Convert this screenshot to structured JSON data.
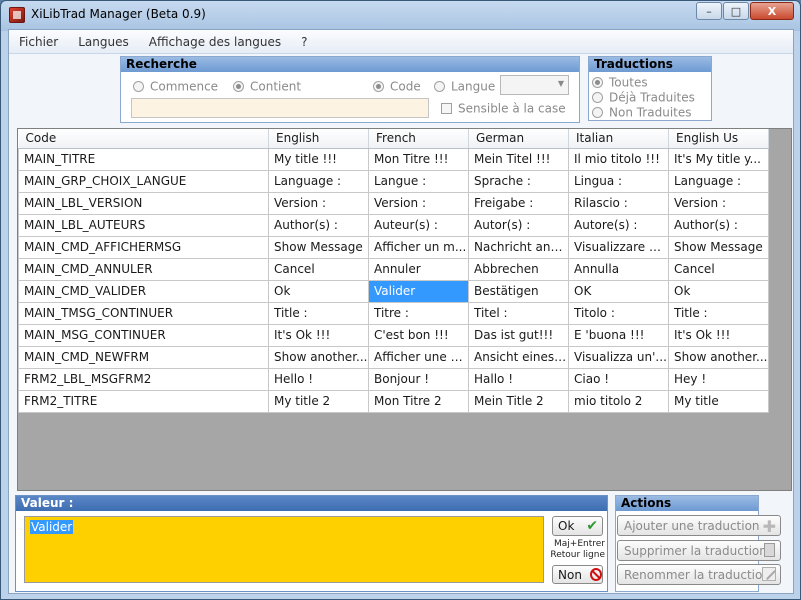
{
  "window": {
    "title": "XiLibTrad Manager (Beta 0.9)",
    "min": "–",
    "max": "□",
    "close": "X"
  },
  "menu": [
    "Fichier",
    "Langues",
    "Affichage des langues",
    "?"
  ],
  "recherche": {
    "title": "Recherche",
    "commence": "Commence",
    "contient": "Contient",
    "code": "Code",
    "langue": "Langue",
    "sensible": "Sensible à la case",
    "search_value": ""
  },
  "traductions": {
    "title": "Traductions",
    "toutes": "Toutes",
    "deja": "Déjà Traduites",
    "non": "Non Traduites"
  },
  "grid": {
    "headers": [
      "Code",
      "English",
      "French",
      "German",
      "Italian",
      "English Us"
    ],
    "rows": [
      [
        "MAIN_TITRE",
        "My title !!!",
        "Mon Titre !!!",
        "Mein Titel !!!",
        "Il mio titolo  !!!",
        "It's My title y..."
      ],
      [
        "MAIN_GRP_CHOIX_LANGUE",
        "Language :",
        "Langue :",
        "Sprache :",
        "Lingua  :",
        "Language :"
      ],
      [
        "MAIN_LBL_VERSION",
        "Version :",
        "Version :",
        "Freigabe :",
        "Rilascio  :",
        "Version :"
      ],
      [
        "MAIN_LBL_AUTEURS",
        "Author(s) :",
        "Auteur(s) :",
        "Autor(s) :",
        "Autore(s) :",
        "Author(s) :"
      ],
      [
        "MAIN_CMD_AFFICHERMSG",
        "Show Message",
        "Afficher un m...",
        "Nachricht anz...",
        "Visualizzare u...",
        "Show Message"
      ],
      [
        "MAIN_CMD_ANNULER",
        "Cancel",
        "Annuler",
        "Abbrechen",
        "Annulla",
        "Cancel"
      ],
      [
        "MAIN_CMD_VALIDER",
        "Ok",
        "Valider",
        "Bestätigen",
        "OK",
        "Ok"
      ],
      [
        "MAIN_TMSG_CONTINUER",
        "Title :",
        "Titre :",
        "Titel :",
        "Titolo  :",
        "Title :"
      ],
      [
        "MAIN_MSG_CONTINUER",
        "It's Ok !!!",
        "C'est bon !!!",
        "Das ist gut!!!",
        "E 'buona !!!",
        "It's Ok !!!"
      ],
      [
        "MAIN_CMD_NEWFRM",
        "Show another...",
        "Afficher une a...",
        "Ansicht eines ...",
        "Visualizza un'...",
        "Show another..."
      ],
      [
        "FRM2_LBL_MSGFRM2",
        "Hello !",
        "Bonjour !",
        "Hallo !",
        "Ciao !",
        "Hey !"
      ],
      [
        "FRM2_TITRE",
        "My title 2",
        "Mon Titre 2",
        "Mein Title 2",
        "mio titolo 2",
        "My title"
      ]
    ]
  },
  "valeur": {
    "title": "Valeur :",
    "text": "Valider",
    "ok": "Ok",
    "hint1": "Maj+Entrer",
    "hint2": "Retour ligne",
    "non": "Non"
  },
  "actions": {
    "title": "Actions",
    "ajouter": "Ajouter une traduction",
    "supprimer": "Supprimer la traduction",
    "renommer": "Renommer la traduction"
  }
}
